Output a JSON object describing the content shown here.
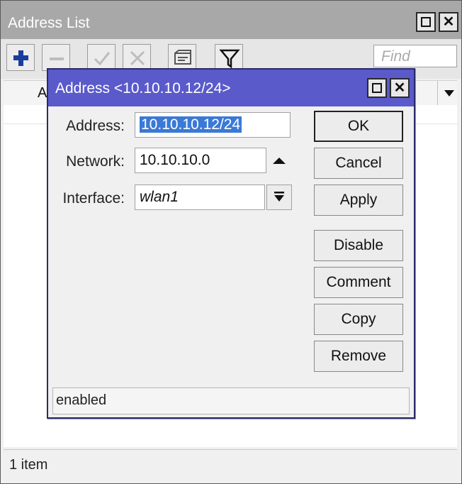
{
  "window": {
    "title": "Address List"
  },
  "toolbar": {
    "find_placeholder": "Find"
  },
  "list": {
    "partial_header": "A",
    "status": "1 item"
  },
  "dialog": {
    "title": "Address <10.10.10.12/24>",
    "fields": {
      "address": {
        "label": "Address:",
        "value": "10.10.10.12/24"
      },
      "network": {
        "label": "Network:",
        "value": "10.10.10.0"
      },
      "interface": {
        "label": "Interface:",
        "value": "wlan1"
      }
    },
    "buttons": {
      "ok": "OK",
      "cancel": "Cancel",
      "apply": "Apply",
      "disable": "Disable",
      "comment": "Comment",
      "copy": "Copy",
      "remove": "Remove"
    },
    "status": "enabled"
  },
  "colors": {
    "dialog_titlebar": "#5a5acb",
    "window_titlebar": "#a8a8a8",
    "selection": "#3a79d6",
    "add_icon": "#1a3c9e"
  }
}
